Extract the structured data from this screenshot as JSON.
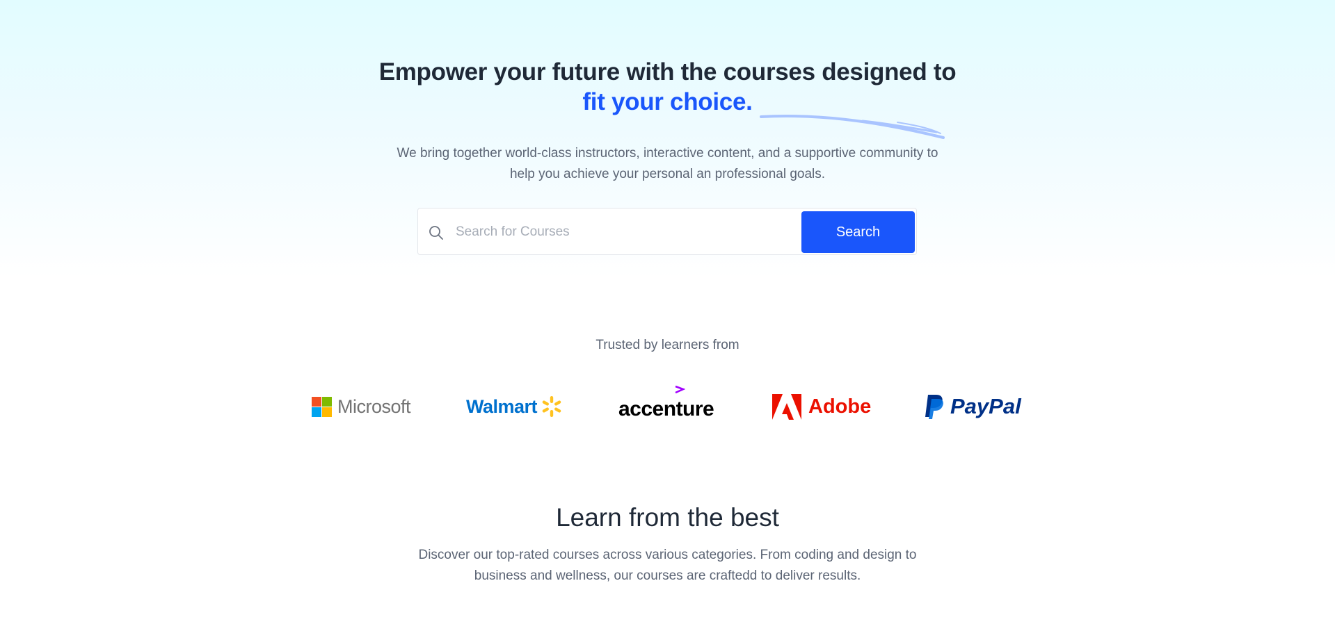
{
  "hero": {
    "headline_line1": "Empower your future with the courses designed to",
    "headline_accent": "fit your choice.",
    "subtitle_line1": "We bring together world-class instructors, interactive content, and a supportive community to",
    "subtitle_line2": "help you achieve your personal an professional goals."
  },
  "search": {
    "placeholder": "Search for Courses",
    "value": "",
    "button_label": "Search",
    "icon": "search-icon"
  },
  "trusted": {
    "label": "Trusted by learners from",
    "logos": [
      {
        "name": "Microsoft",
        "icon": "microsoft-logo"
      },
      {
        "name": "Walmart",
        "icon": "walmart-logo"
      },
      {
        "name": "accenture",
        "icon": "accenture-logo"
      },
      {
        "name": "Adobe",
        "icon": "adobe-logo"
      },
      {
        "name": "PayPal",
        "icon": "paypal-logo"
      }
    ]
  },
  "section": {
    "title": "Learn from the best",
    "subtitle_line1": "Discover our top-rated courses across various categories. From coding and design to",
    "subtitle_line2": "business and wellness, our courses are craftedd to deliver results."
  },
  "colors": {
    "accent": "#1a56fb",
    "heading": "#1f2937",
    "body_text": "#5b6474"
  }
}
